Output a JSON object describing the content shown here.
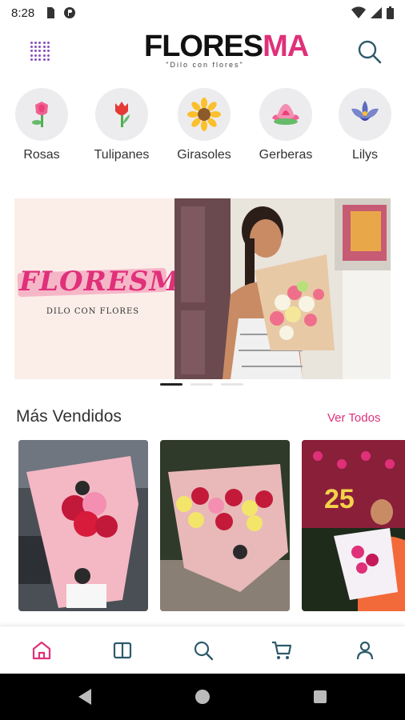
{
  "status_bar": {
    "time": "8:28"
  },
  "header": {
    "logo_primary": "FLORES",
    "logo_accent": "MA",
    "logo_tagline": "\"Dilo con flores\"",
    "menu_icon": "grid-dots-icon",
    "search_icon": "search-icon"
  },
  "categories": [
    {
      "label": "Rosas",
      "icon": "rose-icon"
    },
    {
      "label": "Tulipanes",
      "icon": "tulip-icon"
    },
    {
      "label": "Girasoles",
      "icon": "sunflower-icon"
    },
    {
      "label": "Gerberas",
      "icon": "gerbera-icon"
    },
    {
      "label": "Lilys",
      "icon": "lily-icon"
    }
  ],
  "banner": {
    "brand": "FLORESMA",
    "subtitle": "DILO CON FLORES",
    "page_count": 3,
    "active_page": 1
  },
  "best_sellers": {
    "title": "Más Vendidos",
    "see_all": "Ver Todos",
    "items": [
      {
        "image": "pink-bouquet-with-red-roses"
      },
      {
        "image": "red-and-yellow-rose-bouquet"
      },
      {
        "image": "woman-holding-rose-bouquet-25"
      }
    ]
  },
  "bottom_nav": [
    {
      "id": "home",
      "icon": "home-icon",
      "active": true
    },
    {
      "id": "catalog",
      "icon": "book-icon",
      "active": false
    },
    {
      "id": "search",
      "icon": "search-icon",
      "active": false
    },
    {
      "id": "cart",
      "icon": "cart-icon",
      "active": false
    },
    {
      "id": "profile",
      "icon": "user-icon",
      "active": false
    }
  ],
  "colors": {
    "accent": "#e0307a",
    "category_bg": "#ececef",
    "nav_icon": "#2d5b6b"
  }
}
